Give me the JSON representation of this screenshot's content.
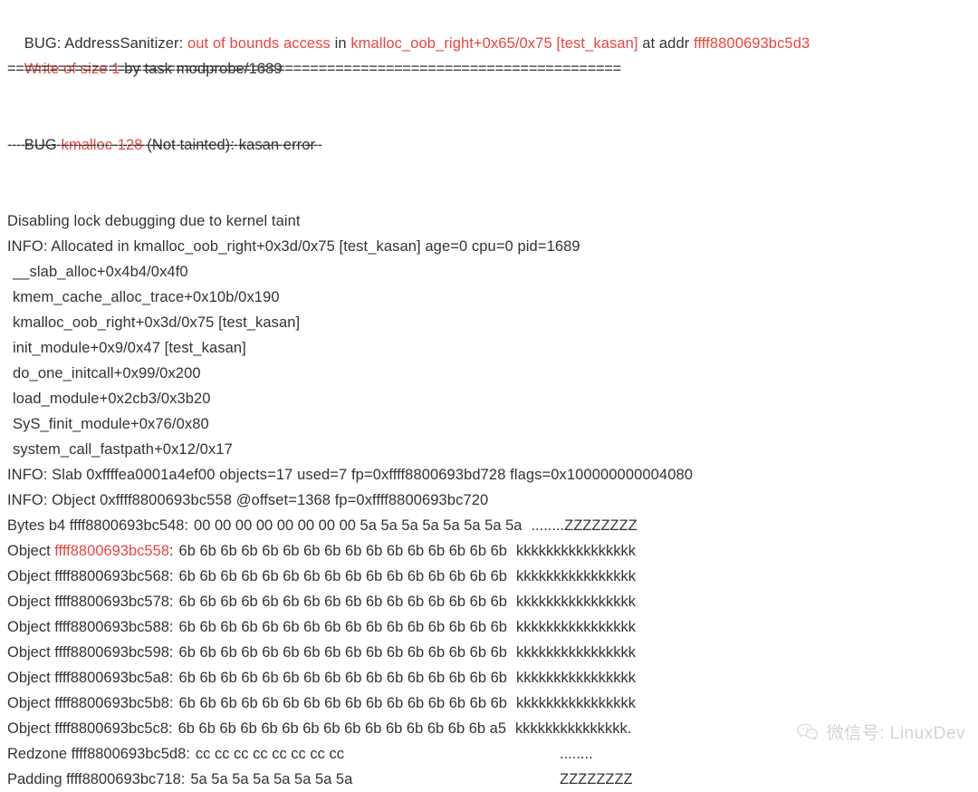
{
  "report": {
    "header_lines": [
      {
        "id": "bug-line",
        "segments": [
          {
            "text": "BUG: AddressSanitizer: ",
            "color": "default"
          },
          {
            "text": "out of bounds access",
            "color": "red"
          },
          {
            "text": " in ",
            "color": "default"
          },
          {
            "text": "kmalloc_oob_right+0x65/0x75 [test_kasan]",
            "color": "red"
          },
          {
            "text": " at addr ",
            "color": "default"
          },
          {
            "text": "ffff8800693bc5d3",
            "color": "red"
          }
        ]
      },
      {
        "id": "write-line",
        "segments": [
          {
            "text": "Write of size 1",
            "color": "red"
          },
          {
            "text": " by task modprobe/1689",
            "color": "default"
          }
        ]
      }
    ],
    "separator_equals": "=========================================================================",
    "bug_slab_line": {
      "segments": [
        {
          "text": "BUG ",
          "color": "default"
        },
        {
          "text": "kmalloc-128",
          "color": "red"
        },
        {
          "text": " (Not tainted): kasan error",
          "color": "default"
        }
      ]
    },
    "separator_dashes": "-----------------------------------------------------------------------",
    "body_lines": [
      "Disabling lock debugging due to kernel taint",
      "INFO: Allocated in kmalloc_oob_right+0x3d/0x75 [test_kasan] age=0 cpu=0 pid=1689"
    ],
    "stack_trace": [
      "__slab_alloc+0x4b4/0x4f0",
      "kmem_cache_alloc_trace+0x10b/0x190",
      "kmalloc_oob_right+0x3d/0x75 [test_kasan]",
      "init_module+0x9/0x47 [test_kasan]",
      "do_one_initcall+0x99/0x200",
      "load_module+0x2cb3/0x3b20",
      "SyS_finit_module+0x76/0x80",
      "system_call_fastpath+0x12/0x17"
    ],
    "info_lines": [
      "INFO: Slab 0xffffea0001a4ef00 objects=17 used=7 fp=0xffff8800693bd728 flags=0x100000000004080",
      "INFO: Object 0xffff8800693bc558 @offset=1368 fp=0xffff8800693bc720"
    ],
    "hexdump": [
      {
        "label": "Bytes b4 ",
        "address": "ffff8800693bc548",
        "address_color": "default",
        "bytes": "00 00 00 00 00 00 00 00 5a 5a 5a 5a 5a 5a 5a 5a",
        "ascii": "........ZZZZZZZZ",
        "short": false
      },
      {
        "label": "Object ",
        "address": "ffff8800693bc558",
        "address_color": "red",
        "bytes": "6b 6b 6b 6b 6b 6b 6b 6b 6b 6b 6b 6b 6b 6b 6b 6b",
        "ascii": "kkkkkkkkkkkkkkkk",
        "short": false
      },
      {
        "label": "Object ",
        "address": "ffff8800693bc568",
        "address_color": "default",
        "bytes": "6b 6b 6b 6b 6b 6b 6b 6b 6b 6b 6b 6b 6b 6b 6b 6b",
        "ascii": "kkkkkkkkkkkkkkkk",
        "short": false
      },
      {
        "label": "Object ",
        "address": "ffff8800693bc578",
        "address_color": "default",
        "bytes": "6b 6b 6b 6b 6b 6b 6b 6b 6b 6b 6b 6b 6b 6b 6b 6b",
        "ascii": "kkkkkkkkkkkkkkkk",
        "short": false
      },
      {
        "label": "Object ",
        "address": "ffff8800693bc588",
        "address_color": "default",
        "bytes": "6b 6b 6b 6b 6b 6b 6b 6b 6b 6b 6b 6b 6b 6b 6b 6b",
        "ascii": "kkkkkkkkkkkkkkkk",
        "short": false
      },
      {
        "label": "Object ",
        "address": "ffff8800693bc598",
        "address_color": "default",
        "bytes": "6b 6b 6b 6b 6b 6b 6b 6b 6b 6b 6b 6b 6b 6b 6b 6b",
        "ascii": "kkkkkkkkkkkkkkkk",
        "short": false
      },
      {
        "label": "Object ",
        "address": "ffff8800693bc5a8",
        "address_color": "default",
        "bytes": "6b 6b 6b 6b 6b 6b 6b 6b 6b 6b 6b 6b 6b 6b 6b 6b",
        "ascii": "kkkkkkkkkkkkkkkk",
        "short": false
      },
      {
        "label": "Object ",
        "address": "ffff8800693bc5b8",
        "address_color": "default",
        "bytes": "6b 6b 6b 6b 6b 6b 6b 6b 6b 6b 6b 6b 6b 6b 6b 6b",
        "ascii": "kkkkkkkkkkkkkkkk",
        "short": false
      },
      {
        "label": "Object ",
        "address": "ffff8800693bc5c8",
        "address_color": "default",
        "bytes": "6b 6b 6b 6b 6b 6b 6b 6b 6b 6b 6b 6b 6b 6b 6b a5",
        "ascii": "kkkkkkkkkkkkkkk.",
        "short": false
      },
      {
        "label": "Redzone ",
        "address": "ffff8800693bc5d8",
        "address_color": "default",
        "bytes": "cc cc cc cc cc cc cc cc",
        "ascii": "........",
        "short": true
      },
      {
        "label": "Padding ",
        "address": "ffff8800693bc718",
        "address_color": "default",
        "bytes": "5a 5a 5a 5a 5a 5a 5a 5a",
        "ascii": "ZZZZZZZZ",
        "short": true
      }
    ]
  },
  "watermark": {
    "icon": "wechat-bubble-icon",
    "text": "微信号: LinuxDev",
    "color": "#d3d3d3"
  }
}
